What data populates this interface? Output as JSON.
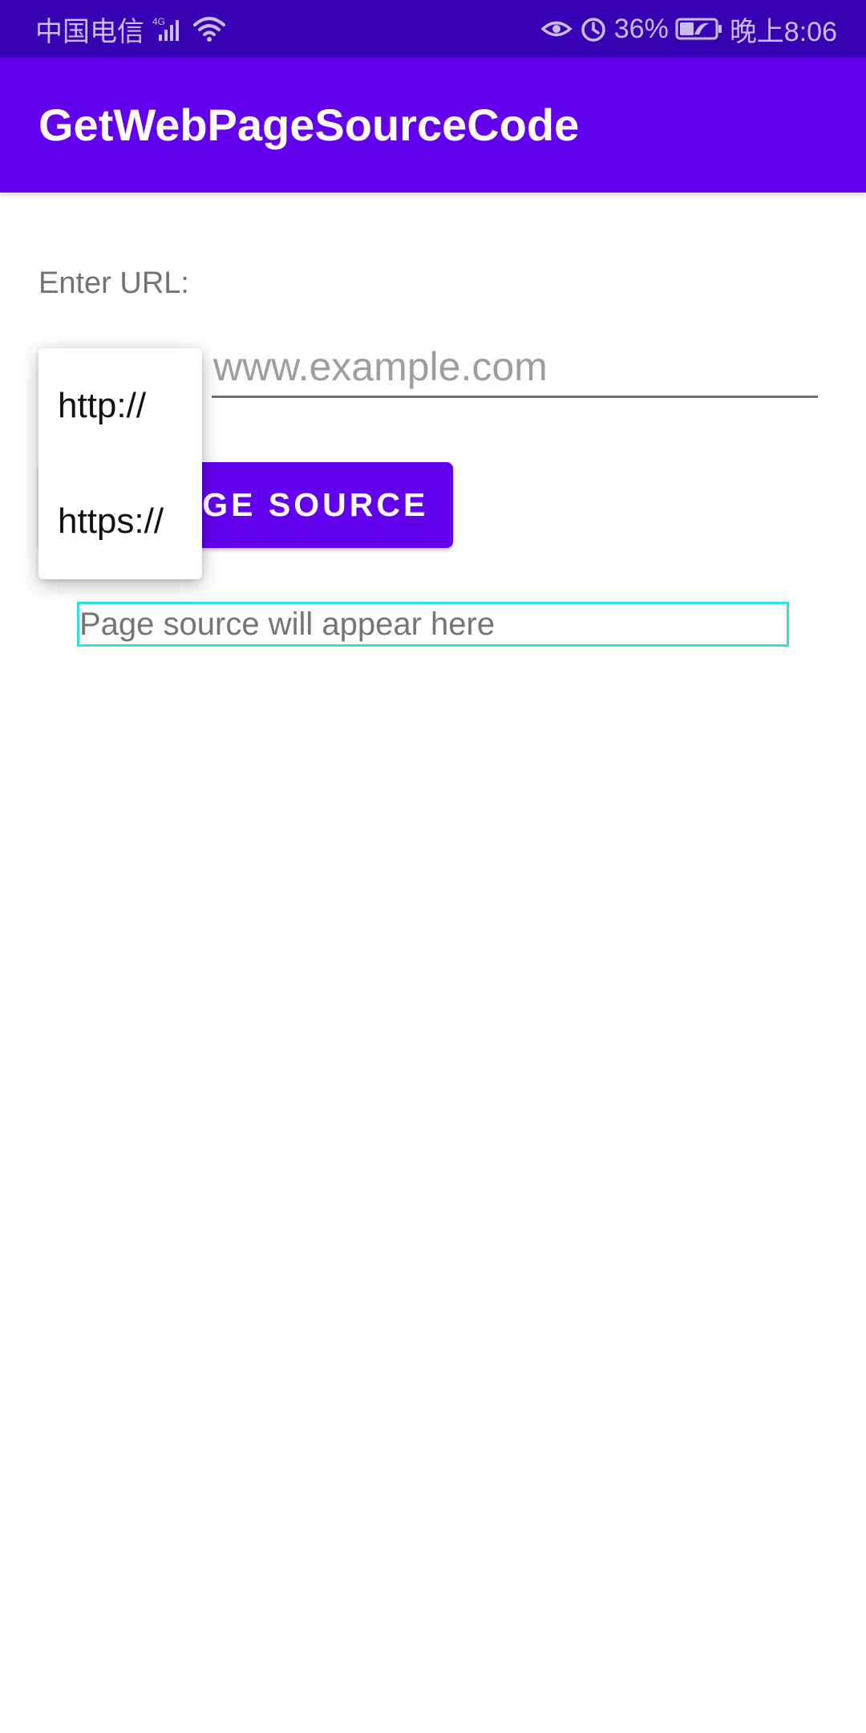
{
  "status_bar": {
    "carrier": "中国电信",
    "network": "4G",
    "battery": "36%",
    "time": "晚上8:06",
    "icons": [
      "signal-icon",
      "wifi-icon",
      "eye-icon",
      "alarm-icon",
      "battery-icon"
    ]
  },
  "app_bar": {
    "title": "GetWebPageSourceCode"
  },
  "form": {
    "url_label": "Enter URL:",
    "url_placeholder": "www.example.com",
    "button_label": "Get Page Source",
    "output_text": "Page source will appear here"
  },
  "protocol_menu": {
    "options": [
      "http://",
      "https://"
    ]
  },
  "colors": {
    "primary": "#6200ee",
    "primary_dark": "#3700b3",
    "output_border": "#2ee0e0"
  }
}
